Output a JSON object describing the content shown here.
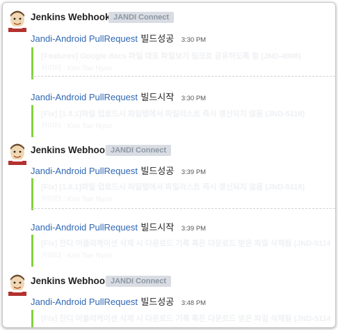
{
  "messages": [
    {
      "sender": "Jenkins Webhook",
      "badge": "JANDI Connect",
      "items": [
        {
          "repo": "Jandi-Android PullRequest",
          "status": "빌드성공",
          "time": "3:30 PM",
          "title": "[Features] Google docs 파일 대표 파일보기 링크로 공유하도록 함 (JND-4908)",
          "sub": "커미터 : Kim Tae Nyun"
        },
        {
          "repo": "Jandi-Android PullRequest",
          "status": "빌드시작",
          "time": "3:30 PM",
          "title": "[Fix] [1.8.1]파일 업로드시 파일탭에서 파일리스트 즉시 갱신되지 않음 (JND-5118)",
          "sub": "커미터 : Kim Tae Nyun"
        }
      ]
    },
    {
      "sender": "Jenkins Webhook",
      "badge": "JANDI Connect",
      "items": [
        {
          "repo": "Jandi-Android PullRequest",
          "status": "빌드성공",
          "time": "3:39 PM",
          "title": "[Fix] [1.8.1]파일 업로드시 파일탭에서 파일리스트 즉시 갱신되지 않음 (JND-5118)",
          "sub": "커미터 : Kim Tae Nyun"
        },
        {
          "repo": "Jandi-Android PullRequest",
          "status": "빌드시작",
          "time": "3:39 PM",
          "title": "[Fix] 잔디 어플리케이션 삭제 시 다운로드 기록 혹은 다운로드 받은 파일 삭제됨 (JND-5114-",
          "sub": "커미터 : Kim Tae Nyun"
        }
      ]
    },
    {
      "sender": "Jenkins Webhook",
      "badge": "JANDI Connect",
      "items": [
        {
          "repo": "Jandi-Android PullRequest",
          "status": "빌드성공",
          "time": "3:48 PM",
          "title": "[Fix] 잔디 어플리케이션 삭제 시 다운로드 기록 혹은 다운로드 받은 파일 삭제됨 (JND-5114-",
          "sub": ""
        }
      ]
    }
  ]
}
